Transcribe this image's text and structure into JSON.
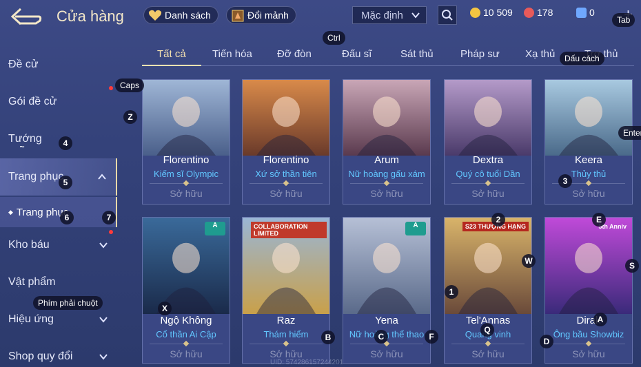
{
  "header": {
    "title": "Cửa hàng",
    "list_label": "Danh sách",
    "exchange_label": "Đổi mảnh",
    "sort_value": "Mặc định",
    "currency": [
      {
        "name": "gold",
        "value": "10 509",
        "color": "#f4c542"
      },
      {
        "name": "gem",
        "value": "178",
        "color": "#e85a5a"
      },
      {
        "name": "voucher",
        "value": "0",
        "color": "#6fa8ff"
      }
    ],
    "plus": "+"
  },
  "sidebar": {
    "items": [
      {
        "label": "Đề cử"
      },
      {
        "label": "Gói đề cử"
      },
      {
        "label": "Tướng"
      },
      {
        "label": "Trang phục"
      },
      {
        "label": "Trang phục"
      },
      {
        "label": "Kho báu"
      },
      {
        "label": "Vật phẩm"
      },
      {
        "label": "Hiệu ứng"
      },
      {
        "label": "Shop quy đổi"
      }
    ]
  },
  "tabs": [
    "Tất cả",
    "Tiến hóa",
    "Đỡ đòn",
    "Đấu sĩ",
    "Sát thủ",
    "Pháp sư",
    "Xạ thủ",
    "Trợ thủ"
  ],
  "cards": [
    {
      "hero": "Florentino",
      "skin": "Kiếm sĩ Olympic",
      "status": "Sở hữu",
      "bg1": "#9fb6d6",
      "bg2": "#4a5f8a"
    },
    {
      "hero": "Florentino",
      "skin": "Xứ sở thần tiên",
      "status": "Sở hữu",
      "bg1": "#d98a4a",
      "bg2": "#6a3a2a"
    },
    {
      "hero": "Arum",
      "skin": "Nữ hoàng gấu xám",
      "status": "Sở hữu",
      "bg1": "#c9a6b6",
      "bg2": "#5a3a4e"
    },
    {
      "hero": "Dextra",
      "skin": "Quý cô tuổi Dần",
      "status": "Sở hữu",
      "bg1": "#b49ac9",
      "bg2": "#4a3a6a"
    },
    {
      "hero": "Keera",
      "skin": "Thủy thủ",
      "status": "Sở hữu",
      "bg1": "#a8c9e0",
      "bg2": "#4a6a8a"
    },
    {
      "hero": "Ngộ Không",
      "skin": "Cổ thần Ai Cập",
      "status": "Sở hữu",
      "bg1": "#3a6a9a",
      "bg2": "#1a2a4a",
      "badge": "A"
    },
    {
      "hero": "Raz",
      "skin": "Thám hiểm",
      "status": "Sở hữu",
      "bg1": "#9ab6d6",
      "bg2": "#c9a04a",
      "tag": "COLLABORATION LIMITED"
    },
    {
      "hero": "Yena",
      "skin": "Nữ hoàng thể thao",
      "status": "Sở hữu",
      "bg1": "#b6c0d6",
      "bg2": "#5a6a8a",
      "badge": "A"
    },
    {
      "hero": "Tel'Annas",
      "skin": "Quang vinh",
      "status": "Sở hữu",
      "bg1": "#d9b46a",
      "bg2": "#6a4a3a",
      "tag": "S23 THƯỢNG HẠNG"
    },
    {
      "hero": "Dirak",
      "skin": "Ông bầu Showbiz",
      "status": "Sở hữu",
      "bg1": "#c04ad9",
      "bg2": "#3a2a7a",
      "tag": "5th Anniv"
    }
  ],
  "key_hints": {
    "ctrl": "Ctrl",
    "tab": "Tab",
    "space": "Dấu cách",
    "caps": "Caps",
    "enter": "Enter",
    "rclick": "Phím phải chuột",
    "z": "Z",
    "k4": "4",
    "k5": "5",
    "k6": "6",
    "k7": "7",
    "k3": "3",
    "k2": "2",
    "e": "E",
    "w": "W",
    "s": "S",
    "x": "X",
    "b": "B",
    "c": "C",
    "f": "F",
    "q": "Q",
    "k1": "1",
    "a": "A",
    "d": "D",
    "tilde": "~"
  },
  "uid": "UID: 574286157244201"
}
